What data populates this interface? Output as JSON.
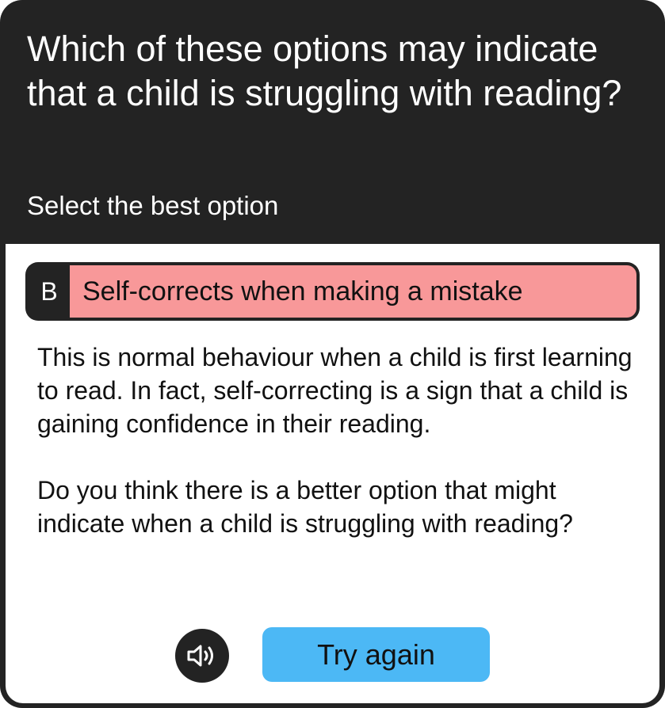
{
  "question": {
    "title": "Which of these options may indicate that a child is struggling with reading?",
    "instruction": "Select the best option"
  },
  "answer": {
    "letter": "B",
    "text": "Self-corrects when making a mistake",
    "state": "incorrect",
    "highlight_color": "#f89899"
  },
  "feedback": {
    "paragraph1": "This is normal behaviour when a child is first learning to read. In fact, self-correcting is a sign that a child is gaining confidence in their reading.",
    "paragraph2": "Do you think there is a better option that might indicate when a child is struggling with reading?"
  },
  "actions": {
    "audio_icon": "speaker-icon",
    "try_again_label": "Try again",
    "try_again_color": "#4cb8f5"
  }
}
